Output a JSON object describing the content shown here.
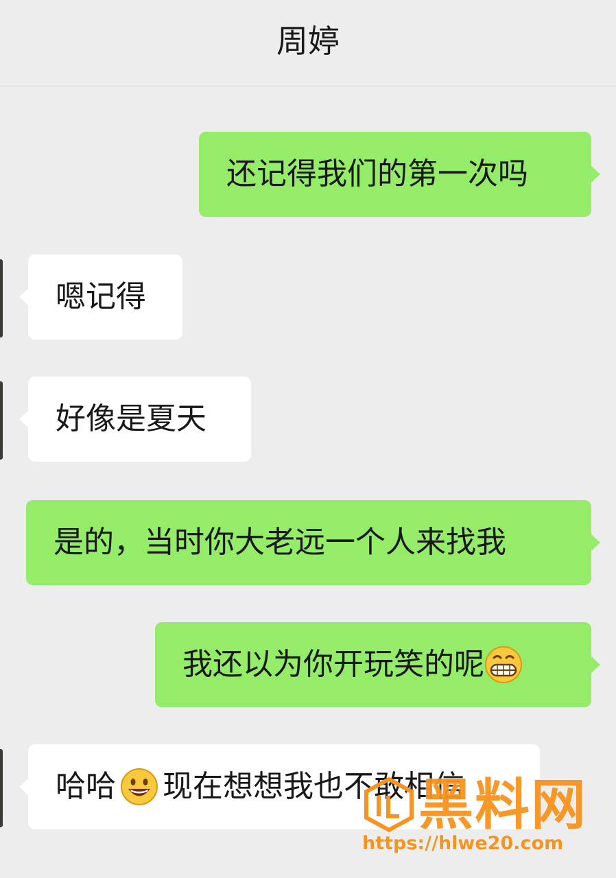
{
  "header": {
    "title": "周婷"
  },
  "messages": [
    {
      "side": "sent",
      "text": "还记得我们的第一次吗"
    },
    {
      "side": "received",
      "text": "嗯记得"
    },
    {
      "side": "received",
      "text": "好像是夏天"
    },
    {
      "side": "sent",
      "text": "是的，当时你大老远一个人来找我"
    },
    {
      "side": "sent",
      "text": "我还以为你开玩笑的呢",
      "emoji": "grinning-face-icon"
    },
    {
      "side": "received",
      "text_before": "哈哈",
      "emoji": "smiling-face-icon",
      "text_after": "现在想想我也不敢相信"
    }
  ],
  "watermark": {
    "logo_text": "黑料网",
    "url": "https://hlwe20.com"
  },
  "colors": {
    "background": "#ededed",
    "sent_bubble": "#95ec69",
    "received_bubble": "#ffffff",
    "watermark": "#f7931e"
  }
}
